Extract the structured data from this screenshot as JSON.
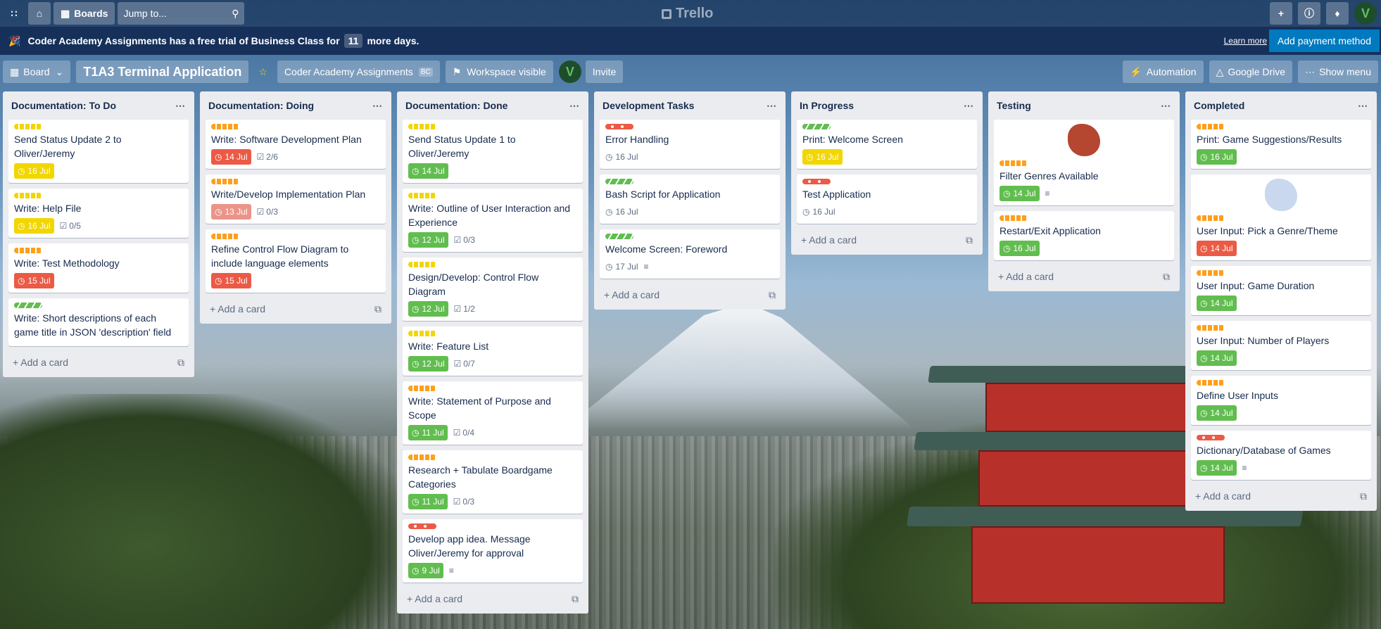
{
  "app": {
    "name": "Trello"
  },
  "topbar": {
    "boards_label": "Boards",
    "jump_placeholder": "Jump to...",
    "avatar": "V"
  },
  "trial": {
    "prefix": "Coder Academy Assignments has a free trial of Business Class for",
    "days": "11",
    "suffix": "more days.",
    "learn_more": "Learn more",
    "add_payment": "Add payment method"
  },
  "board": {
    "view_label": "Board",
    "title": "T1A3 Terminal Application",
    "workspace": "Coder Academy Assignments",
    "workspace_badge": "BC",
    "visibility": "Workspace visible",
    "invite": "Invite",
    "automation": "Automation",
    "google_drive": "Google Drive",
    "show_menu": "Show menu"
  },
  "add_card_label": "Add a card",
  "lists": [
    {
      "title": "Documentation: To Do",
      "cards": [
        {
          "labels": [
            "yellow"
          ],
          "title": "Send Status Update 2 to Oliver/Jeremy",
          "due": "16 Jul",
          "due_color": "yellow"
        },
        {
          "labels": [
            "yellow"
          ],
          "title": "Write: Help File",
          "due": "16 Jul",
          "due_color": "yellow",
          "checklist": "0/5"
        },
        {
          "labels": [
            "orange"
          ],
          "title": "Write: Test Methodology",
          "due": "15 Jul",
          "due_color": "red"
        },
        {
          "labels": [
            "green"
          ],
          "title": "Write: Short descriptions of each game title in JSON 'description' field"
        }
      ]
    },
    {
      "title": "Documentation: Doing",
      "cards": [
        {
          "labels": [
            "orange"
          ],
          "title": "Write: Software Development Plan",
          "due": "14 Jul",
          "due_color": "red",
          "checklist": "2/6"
        },
        {
          "labels": [
            "orange"
          ],
          "title": "Write/Develop Implementation Plan",
          "due": "13 Jul",
          "due_color": "pink",
          "checklist": "0/3"
        },
        {
          "labels": [
            "orange"
          ],
          "title": "Refine Control Flow Diagram to include language elements",
          "due": "15 Jul",
          "due_color": "red"
        }
      ]
    },
    {
      "title": "Documentation: Done",
      "cards": [
        {
          "labels": [
            "yellow"
          ],
          "title": "Send Status Update 1 to Oliver/Jeremy",
          "due": "14 Jul",
          "due_color": "green"
        },
        {
          "labels": [
            "yellow"
          ],
          "title": "Write: Outline of User Interaction and Experience",
          "due": "12 Jul",
          "due_color": "green",
          "checklist": "0/3"
        },
        {
          "labels": [
            "yellow"
          ],
          "title": "Design/Develop: Control Flow Diagram",
          "due": "12 Jul",
          "due_color": "green",
          "checklist": "1/2"
        },
        {
          "labels": [
            "yellow"
          ],
          "title": "Write: Feature List",
          "due": "12 Jul",
          "due_color": "green",
          "checklist": "0/7"
        },
        {
          "labels": [
            "orange"
          ],
          "title": "Write: Statement of Purpose and Scope",
          "due": "11 Jul",
          "due_color": "green",
          "checklist": "0/4"
        },
        {
          "labels": [
            "orange"
          ],
          "title": "Research + Tabulate Boardgame Categories",
          "due": "11 Jul",
          "due_color": "green",
          "checklist": "0/3"
        },
        {
          "labels": [
            "red"
          ],
          "title": "Develop app idea. Message Oliver/Jeremy for approval",
          "due": "9 Jul",
          "due_color": "green",
          "description": true
        }
      ]
    },
    {
      "title": "Development Tasks",
      "cards": [
        {
          "labels": [
            "red"
          ],
          "title": "Error Handling",
          "due": "16 Jul",
          "due_color": "none"
        },
        {
          "labels": [
            "green"
          ],
          "title": "Bash Script for Application",
          "due": "16 Jul",
          "due_color": "none"
        },
        {
          "labels": [
            "green"
          ],
          "title": "Welcome Screen: Foreword",
          "due": "17 Jul",
          "due_color": "none",
          "description": true
        }
      ]
    },
    {
      "title": "In Progress",
      "cards": [
        {
          "labels": [
            "green"
          ],
          "title": "Print: Welcome Screen",
          "due": "16 Jul",
          "due_color": "yellow"
        },
        {
          "labels": [
            "red"
          ],
          "title": "Test Application",
          "due": "16 Jul",
          "due_color": "none"
        }
      ]
    },
    {
      "title": "Testing",
      "cards": [
        {
          "cover": "sticker",
          "cover_color": "#b5462f",
          "labels": [
            "orange"
          ],
          "title": "Filter Genres Available",
          "due": "14 Jul",
          "due_color": "green",
          "description": true
        },
        {
          "labels": [
            "orange"
          ],
          "title": "Restart/Exit Application",
          "due": "16 Jul",
          "due_color": "green"
        }
      ]
    },
    {
      "title": "Completed",
      "cards": [
        {
          "labels": [
            "orange"
          ],
          "title": "Print: Game Suggestions/Results",
          "due": "16 Jul",
          "due_color": "green"
        },
        {
          "cover": "sticker",
          "cover_color": "#c9d8ee",
          "labels": [
            "orange"
          ],
          "title": "User Input: Pick a Genre/Theme",
          "due": "14 Jul",
          "due_color": "red"
        },
        {
          "labels": [
            "orange"
          ],
          "title": "User Input: Game Duration",
          "due": "14 Jul",
          "due_color": "green"
        },
        {
          "labels": [
            "orange"
          ],
          "title": "User Input: Number of Players",
          "due": "14 Jul",
          "due_color": "green"
        },
        {
          "labels": [
            "orange"
          ],
          "title": "Define User Inputs",
          "due": "14 Jul",
          "due_color": "green"
        },
        {
          "labels": [
            "red"
          ],
          "title": "Dictionary/Database of Games",
          "due": "14 Jul",
          "due_color": "green",
          "description": true
        }
      ]
    }
  ]
}
